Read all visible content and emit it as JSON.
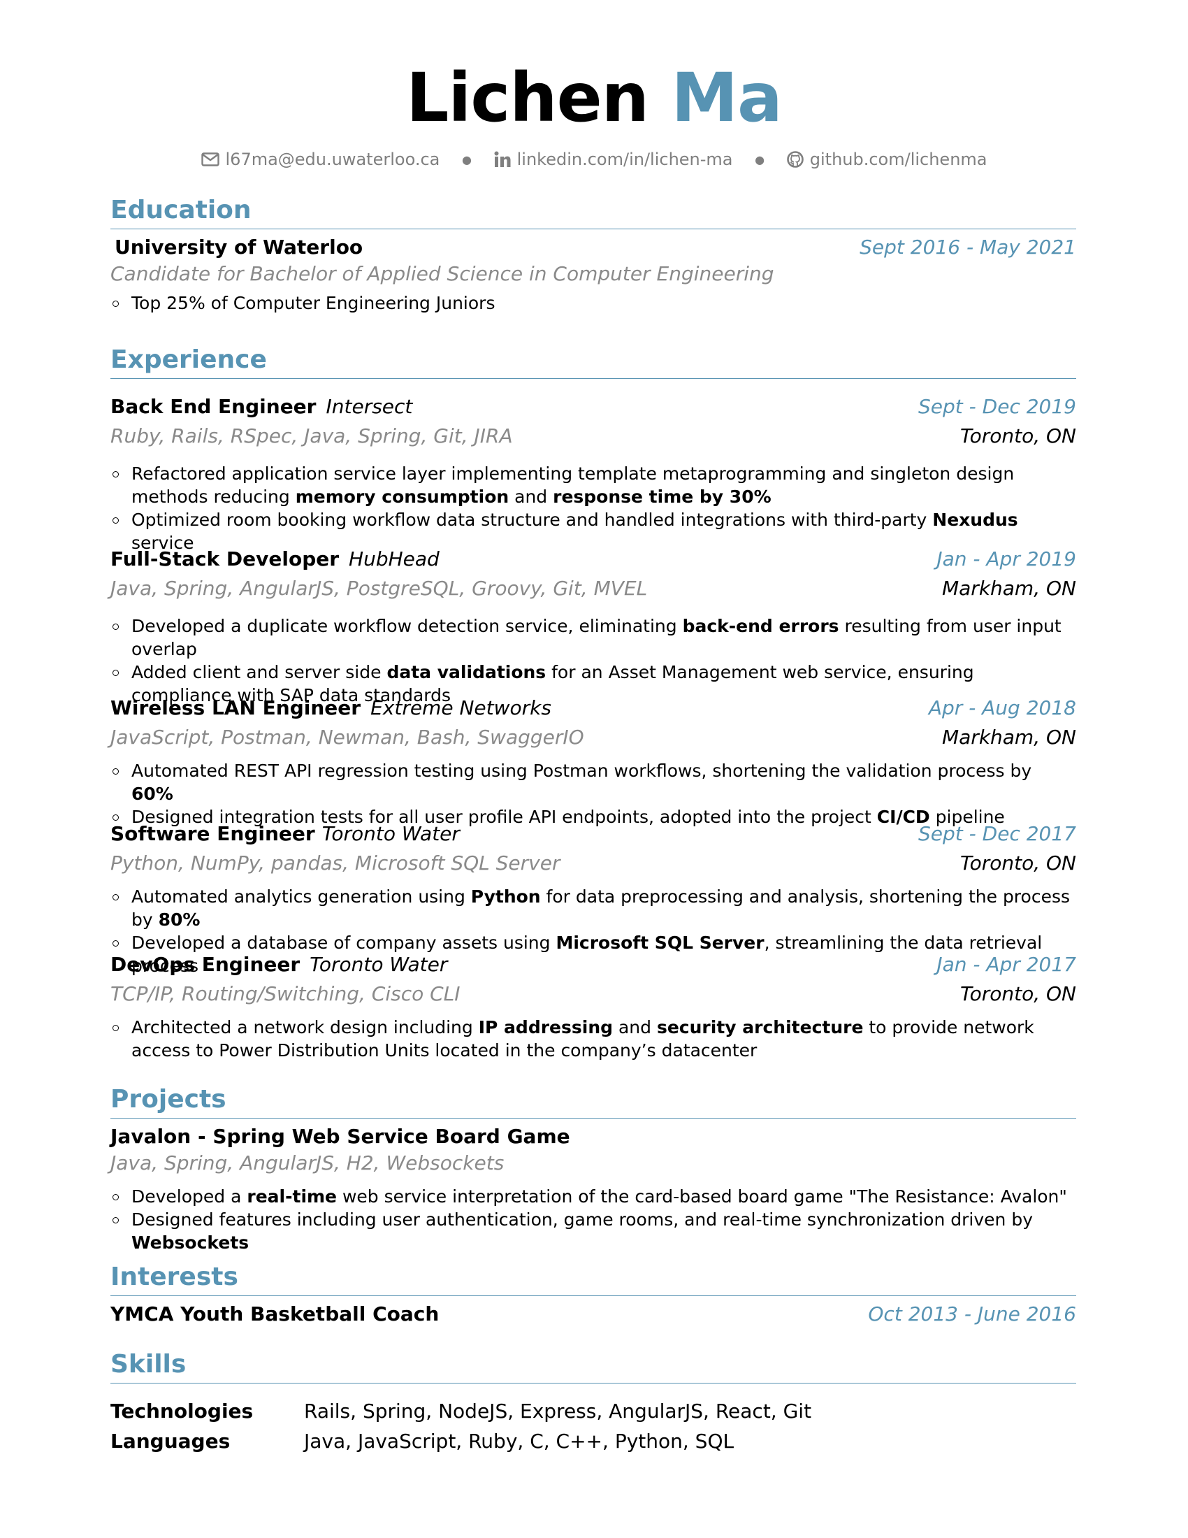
{
  "header": {
    "first_name": "Lichen",
    "last_name": "Ma",
    "email": "l67ma@edu.uwaterloo.ca",
    "linkedin": "linkedin.com/in/lichen-ma",
    "github": "github.com/lichenma",
    "separator": "●"
  },
  "colors": {
    "accent": "#5793b3",
    "muted": "#7f7f7f"
  },
  "education": {
    "title": "Education",
    "school": "University of Waterloo",
    "dates": "Sept 2016 - May 2021",
    "degree": "Candidate for Bachelor of Applied Science in Computer Engineering",
    "bullets": [
      "Top 25% of Computer Engineering Juniors"
    ]
  },
  "experience": {
    "title": "Experience",
    "jobs": [
      {
        "role": "Back End Engineer",
        "company": "Intersect",
        "dates": "Sept - Dec 2019",
        "tech": "Ruby, Rails, RSpec, Java, Spring, Git, JIRA",
        "location": "Toronto, ON",
        "bullets": [
          "Refactored application service layer implementing template metaprogramming and singleton design methods reducing <b>memory consumption</b> and <b>response time by 30%</b>",
          "Optimized room booking workflow data structure and handled integrations with third-party <b>Nexudus</b> service"
        ]
      },
      {
        "role": "Full-Stack Developer",
        "company": "HubHead",
        "dates": "Jan - Apr 2019",
        "tech": "Java, Spring, AngularJS, PostgreSQL, Groovy, Git, MVEL",
        "location": "Markham, ON",
        "bullets": [
          "Developed a duplicate workflow detection service, eliminating <b>back-end errors</b> resulting from user input overlap",
          "Added client and server side <b>data validations</b> for an Asset Management web service, ensuring compliance with SAP data standards"
        ]
      },
      {
        "role": "Wireless LAN Engineer",
        "company": "Extreme Networks",
        "dates": "Apr - Aug 2018",
        "tech": "JavaScript, Postman, Newman, Bash, SwaggerIO",
        "location": "Markham, ON",
        "bullets": [
          "Automated REST API regression testing using Postman workflows, shortening the validation process by <b>60%</b>",
          "Designed integration tests for all user profile API endpoints, adopted into the project <b>CI/CD</b> pipeline"
        ]
      },
      {
        "role": "Software Engineer",
        "company": "Toronto Water",
        "dates": "Sept - Dec 2017",
        "tech": "Python, NumPy, pandas, Microsoft SQL Server",
        "location": "Toronto, ON",
        "bullets": [
          "Automated analytics generation using <b>Python</b> for data preprocessing and analysis, shortening the process by <b>80%</b>",
          "Developed a database of company assets using <b>Microsoft SQL Server</b>, streamlining the data retrieval process"
        ]
      },
      {
        "role": "DevOps Engineer",
        "company": "Toronto Water",
        "dates": "Jan - Apr 2017",
        "tech": "TCP/IP, Routing/Switching, Cisco CLI",
        "location": "Toronto, ON",
        "bullets": [
          "Architected a network design including <b>IP addressing</b> and <b>security architecture</b> to provide network access to Power Distribution Units located in the company’s datacenter"
        ]
      }
    ]
  },
  "projects": {
    "title": "Projects",
    "items": [
      {
        "name": "Javalon - Spring Web Service Board Game",
        "tech": "Java, Spring, AngularJS, H2, Websockets",
        "bullets": [
          "Developed a <b>real-time</b> web service interpretation of the card-based board game \"The Resistance: Avalon\"",
          "Designed features including user authentication, game rooms, and real-time synchronization driven by <b>Websockets</b>"
        ]
      }
    ]
  },
  "interests": {
    "title": "Interests",
    "name": "YMCA Youth Basketball Coach",
    "dates": "Oct 2013 - June 2016"
  },
  "skills": {
    "title": "Skills",
    "rows": [
      {
        "label": "Technologies",
        "value": "Rails, Spring, NodeJS, Express, AngularJS, React, Git"
      },
      {
        "label": "Languages",
        "value": "Java, JavaScript, Ruby, C, C++, Python, SQL"
      }
    ]
  }
}
